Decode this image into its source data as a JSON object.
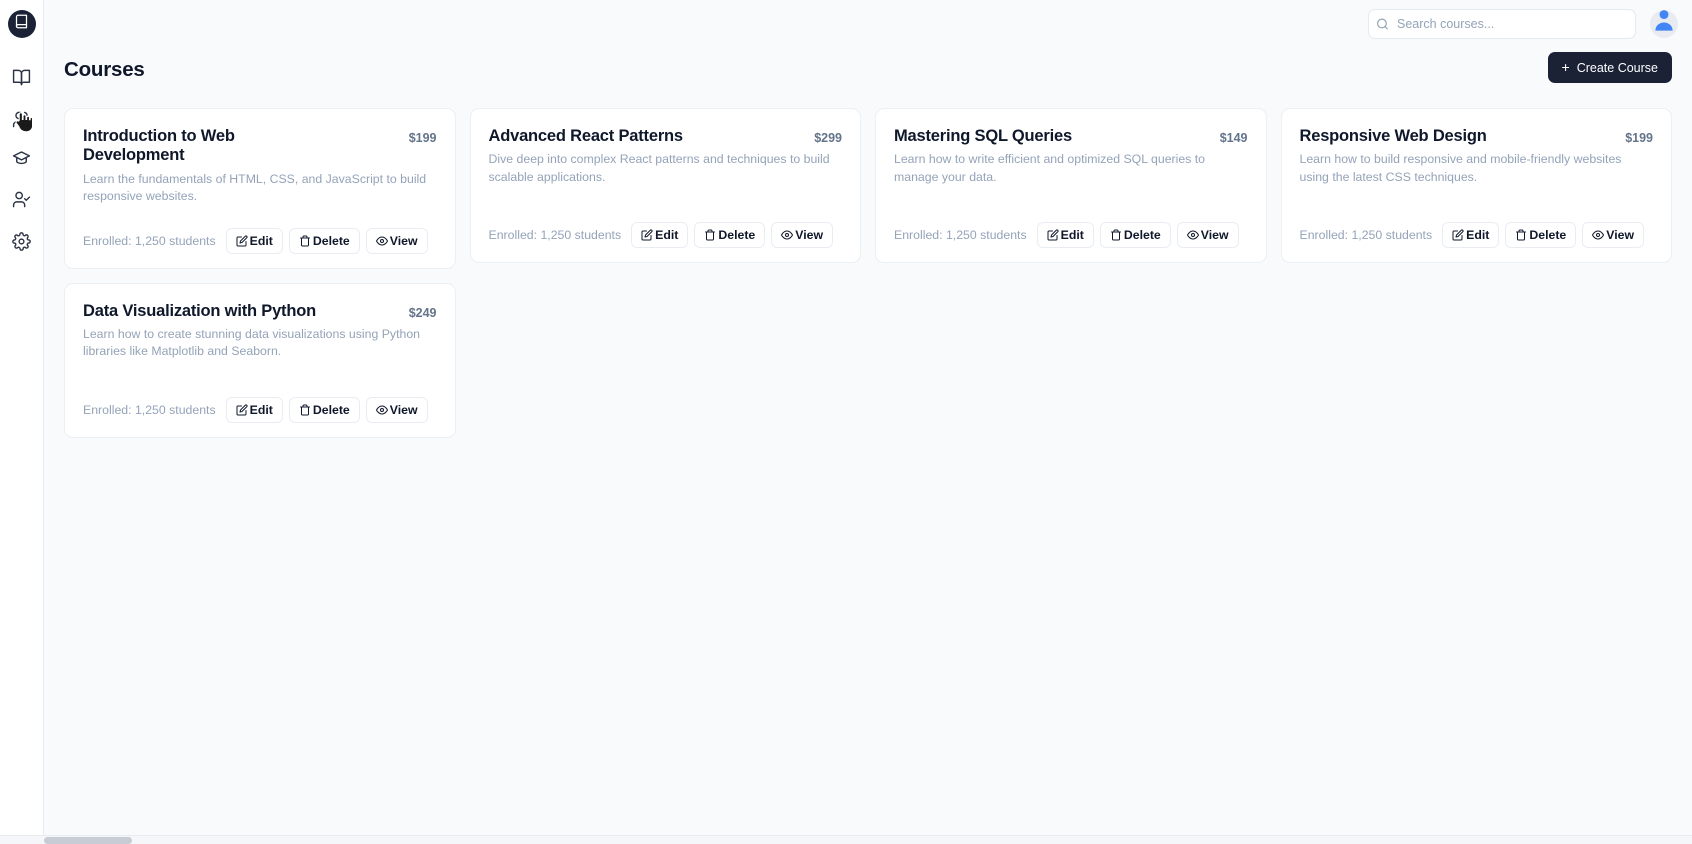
{
  "sidebar": {
    "logo_icon": "book-logo-icon",
    "items": [
      {
        "icon": "book-open-icon",
        "name": "sidebar-item-courses"
      },
      {
        "icon": "users-icon",
        "name": "sidebar-item-students"
      },
      {
        "icon": "graduation-cap-icon",
        "name": "sidebar-item-grades"
      },
      {
        "icon": "user-check-icon",
        "name": "sidebar-item-attendance"
      },
      {
        "icon": "gear-icon",
        "name": "sidebar-item-settings"
      }
    ]
  },
  "topbar": {
    "search": {
      "placeholder": "Search courses...",
      "value": "",
      "icon": "search-icon"
    },
    "avatar_icon": "user-avatar-icon"
  },
  "header": {
    "title": "Courses",
    "create_label": "Create Course",
    "create_plus": "+"
  },
  "actions": {
    "edit_label": "Edit",
    "delete_label": "Delete",
    "view_label": "View",
    "edit_icon": "square-pen-icon",
    "delete_icon": "trash-icon",
    "view_icon": "eye-icon"
  },
  "colors": {
    "accent_dark": "#1b2236",
    "page_bg": "#f8fafc",
    "card_bg": "#ffffff",
    "muted_text": "#94a3b8",
    "price_text": "#64748b",
    "avatar_blue": "#4285f4"
  },
  "courses": [
    {
      "title": "Introduction to Web Development",
      "price": "$199",
      "description": "Learn the fundamentals of HTML, CSS, and JavaScript to build responsive websites.",
      "enrolled": "Enrolled: 1,250 students"
    },
    {
      "title": "Advanced React Patterns",
      "price": "$299",
      "description": "Dive deep into complex React patterns and techniques to build scalable applications.",
      "enrolled": "Enrolled: 1,250 students"
    },
    {
      "title": "Mastering SQL Queries",
      "price": "$149",
      "description": "Learn how to write efficient and optimized SQL queries to manage your data.",
      "enrolled": "Enrolled: 1,250 students"
    },
    {
      "title": "Responsive Web Design",
      "price": "$199",
      "description": "Learn how to build responsive and mobile-friendly websites using the latest CSS techniques.",
      "enrolled": "Enrolled: 1,250 students"
    },
    {
      "title": "Data Visualization with Python",
      "price": "$249",
      "description": "Learn how to create stunning data visualizations using Python libraries like Matplotlib and Seaborn.",
      "enrolled": "Enrolled: 1,250 students"
    }
  ]
}
